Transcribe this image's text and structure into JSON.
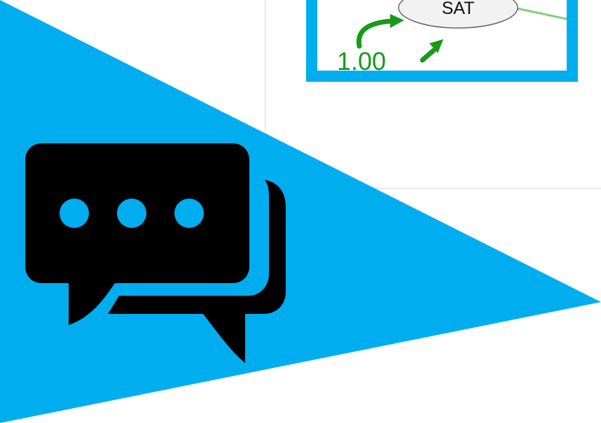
{
  "diagram": {
    "node_label": "SAT",
    "coefficient_label": "1.00"
  },
  "icons": {
    "chat": "chat-bubbles-icon"
  },
  "colors": {
    "accent_blue": "#00aeef",
    "path_green": "#1a9a1a",
    "icon_black": "#000000"
  }
}
